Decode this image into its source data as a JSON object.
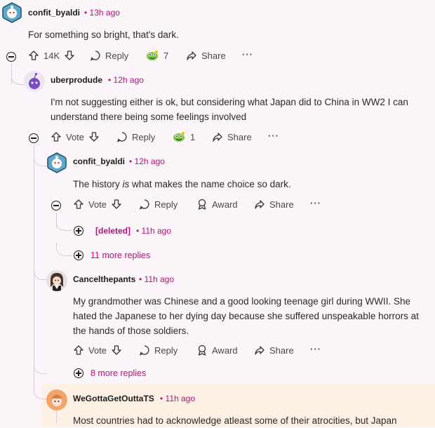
{
  "comments": [
    {
      "username": "confit_byaldi",
      "time": "13h ago",
      "body": [
        "For something so bright, that's dark."
      ],
      "actions": {
        "votes": "14K",
        "reply": "Reply",
        "awards": "7",
        "share": "Share"
      }
    },
    {
      "username": "uberprodude",
      "time": "12h ago",
      "body": [
        "I'm not suggesting either is ok, but considering what Japan did to China in WW2 I can",
        "understand there being some feelings involved"
      ],
      "actions": {
        "votes": "Vote",
        "reply": "Reply",
        "awards": "1",
        "share": "Share"
      }
    },
    {
      "username": "confit_byaldi",
      "time": "12h ago",
      "body_before": "The history ",
      "body_em": "is",
      "body_after": " what makes the name choice so dark.",
      "actions": {
        "votes": "Vote",
        "reply": "Reply",
        "award": "Award",
        "share": "Share"
      }
    },
    {
      "username": "[deleted]",
      "time": "11h ago"
    },
    {
      "username": "Cancelthepants",
      "time": "11h ago",
      "body": [
        "My grandmother was Chinese and a good looking teenage girl during WWII. She",
        "hated the Japanese to her dying day because she suffered unspeakable horrors at",
        "the hands of those soldiers."
      ],
      "actions": {
        "votes": "Vote",
        "reply": "Reply",
        "award": "Award",
        "share": "Share"
      }
    },
    {
      "username": "WeGottaGetOuttaTS",
      "time": "11h ago",
      "body": [
        "Most countries had to acknowledge atleast some of their atrocities, but Japan"
      ]
    }
  ],
  "more_replies": [
    "11 more replies",
    "8 more replies"
  ],
  "separator": "•",
  "ellipsis": "···",
  "colors": {
    "accent": "#b0137a",
    "background": "#fbf4f8",
    "highlight": "#fdf0e4"
  }
}
